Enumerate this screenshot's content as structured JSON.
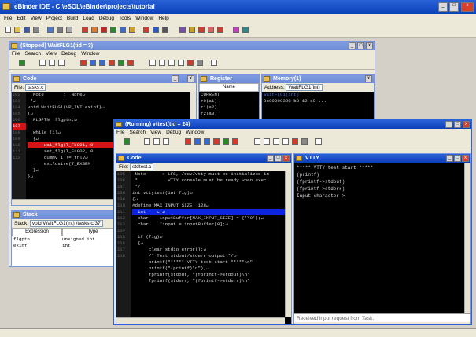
{
  "ide": {
    "title": "eBinder IDE - C:\\eSOL\\eBinder\\projects\\tutorial",
    "menu": [
      "File",
      "Edit",
      "View",
      "Project",
      "Build",
      "Load",
      "Debug",
      "Tools",
      "Window",
      "Help"
    ]
  },
  "dbg1": {
    "title": "(Stopped) WaitFLG1(tid = 3)",
    "menu": [
      "File",
      "Search",
      "View",
      "Debug",
      "Window"
    ]
  },
  "code1": {
    "title": "Code",
    "file_label": "File:",
    "file": "tasks.c",
    "lines": [
      "  Note       :  None↵",
      " *↵",
      "void WaitFLG1(VP_INT exinf)↵",
      "{↵",
      "  FLGPTN  flgptn;↵",
      "",
      "  while (1)↵",
      "  {↵",
      "      wai_flg(T_FLG01, 0",
      "      set_flg(T_FLG02, 0",
      "      dummy_1 != fnly↵",
      "      exclusive(T_EXSEM",
      "  }↵",
      "}↵"
    ],
    "gutter": [
      "",
      "",
      "",
      "102",
      "103",
      "104",
      "105",
      "106",
      "107",
      "108",
      "109",
      "110",
      "111",
      "112"
    ]
  },
  "register": {
    "title": "Register",
    "col": "Name",
    "rows": [
      "CURRENT",
      "  r0(a1)",
      "  r1(a2)",
      "  r2(a3)"
    ]
  },
  "memory": {
    "title": "Memory(1)",
    "addr_label": "Address:",
    "addr": "WaitFLG1(int)",
    "rows": [
      "WaitFLG1(int)",
      "0x00000300  b0 12 e0 ..."
    ]
  },
  "stack": {
    "title": "Stack",
    "label": "Stack:",
    "value": "void WaitFLG1(int) /tasks.c/37",
    "cols": [
      "Expression",
      "Type"
    ],
    "rows": [
      [
        "flgptn",
        "unsigned int"
      ],
      [
        "exinf",
        "int"
      ]
    ]
  },
  "dbg2": {
    "title": "(Running) vttest(tid = 24)",
    "menu": [
      "File",
      "Search",
      "View",
      "Debug",
      "Window"
    ]
  },
  "code2": {
    "title": "Code",
    "file_label": "File:",
    "file": "stdtest.c",
    "lines": [
      " Note      : LFS, /dev/vtty must be initialized in",
      " *           VTTY console must be ready when exec",
      " */",
      "int vttytest(int fig)↵",
      "{↵",
      "#define MAX_INPUT_SIZE  128↵",
      "  int    c;↵",
      "  char    inputBuffer[MAX_INPUT_SIZE] = {'\\0'};↵",
      "  char    *input = inputBuffer[0];↵",
      "",
      "  if (fig)↵",
      "  {↵",
      "      clear_stdio_error();↵",
      "      /* Test stdout/stderr output */↵",
      "      printf(\"***** VTTY test start *****\\n\"",
      "      printf(\"(printf)\\n\");↵",
      "      fprintf(stdout, \"(fprintf->stdout)\\n\"",
      "      fprintf(stderr, \"(fprintf->stderr)\\n\""
    ],
    "gutter": [
      "",
      "",
      "",
      "",
      "105",
      "106",
      "107",
      "108",
      "109",
      "110",
      "111",
      "112",
      "113",
      "114",
      "115",
      "116",
      "117",
      "118"
    ]
  },
  "vtty": {
    "title": "VTTY",
    "lines": [
      "***** VTTY test start *****",
      "(printf)",
      "(fprintf->stdout)",
      "(fprintf->stderr)",
      "Input character >"
    ],
    "status": "Received input request from Task."
  }
}
